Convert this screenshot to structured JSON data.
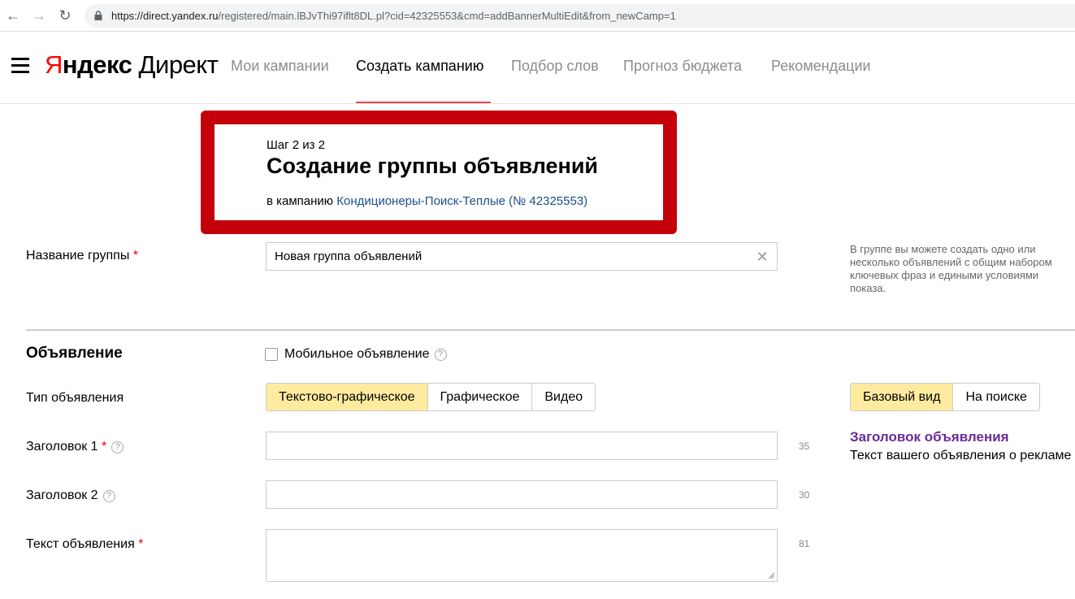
{
  "browser": {
    "url_host": "https://direct.yandex.ru",
    "url_path": "/registered/main.lBJvThi97iflt8DL.pl?cid=42325553&cmd=addBannerMultiEdit&from_newCamp=1"
  },
  "header": {
    "logo_y": "Я",
    "logo_rest": "ндекс",
    "logo_direct": " Директ",
    "tabs": [
      {
        "label": "Мои кампании"
      },
      {
        "label": "Создать кампанию"
      },
      {
        "label": "Подбор слов"
      },
      {
        "label": "Прогноз бюджета"
      },
      {
        "label": "Рекомендации"
      }
    ]
  },
  "step": {
    "counter": "Шаг 2 из 2",
    "title": "Создание группы объявлений",
    "in_campaign_prefix": "в кампанию ",
    "campaign_link": "Кондиционеры-Поиск-Теплые (№ 42325553)"
  },
  "group": {
    "label": "Название группы",
    "required_mark": "*",
    "value": "Новая группа объявлений",
    "hint": "В группе вы можете создать одно или несколько объявлений с общим набором ключевых фраз и едиными условиями показа."
  },
  "ad": {
    "section_title": "Объявление",
    "mobile_checkbox_label": "Мобильное объявление",
    "type_label": "Тип объявления",
    "types": [
      {
        "label": "Текстово-графическое",
        "selected": true
      },
      {
        "label": "Графическое",
        "selected": false
      },
      {
        "label": "Видео",
        "selected": false
      }
    ],
    "view_modes": [
      {
        "label": "Базовый вид",
        "selected": true
      },
      {
        "label": "На поиске",
        "selected": false
      }
    ],
    "title1_label": "Заголовок 1",
    "title1_counter": "35",
    "title2_label": "Заголовок 2",
    "title2_counter": "30",
    "text_label": "Текст объявления",
    "text_counter": "81",
    "preview_title": "Заголовок объявления",
    "preview_text": "Текст вашего объявления о рекламе"
  },
  "colors": {
    "highlight": "#c4010b",
    "selected_segment": "#ffeba0",
    "preview_title": "#6b2a99",
    "link": "#1a4e8c"
  }
}
